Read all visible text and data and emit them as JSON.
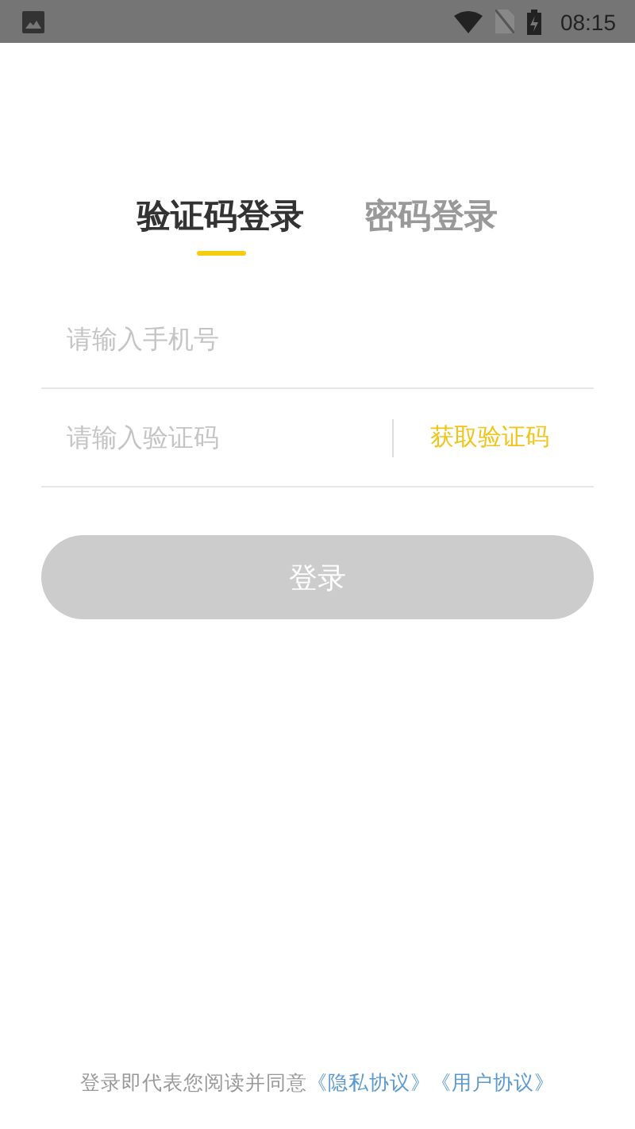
{
  "status_bar": {
    "time": "08:15"
  },
  "tabs": [
    {
      "label": "验证码登录",
      "selected": true
    },
    {
      "label": "密码登录",
      "selected": false
    }
  ],
  "phone_field": {
    "placeholder": "请输入手机号"
  },
  "code_field": {
    "placeholder": "请输入验证码"
  },
  "get_code_button": "获取验证码",
  "login_button": {
    "label": "登录",
    "disabled": true
  },
  "footer": {
    "text": "登录即代表您阅读并同意",
    "links": [
      "《隐私协议》",
      "《用户协议》"
    ]
  }
}
